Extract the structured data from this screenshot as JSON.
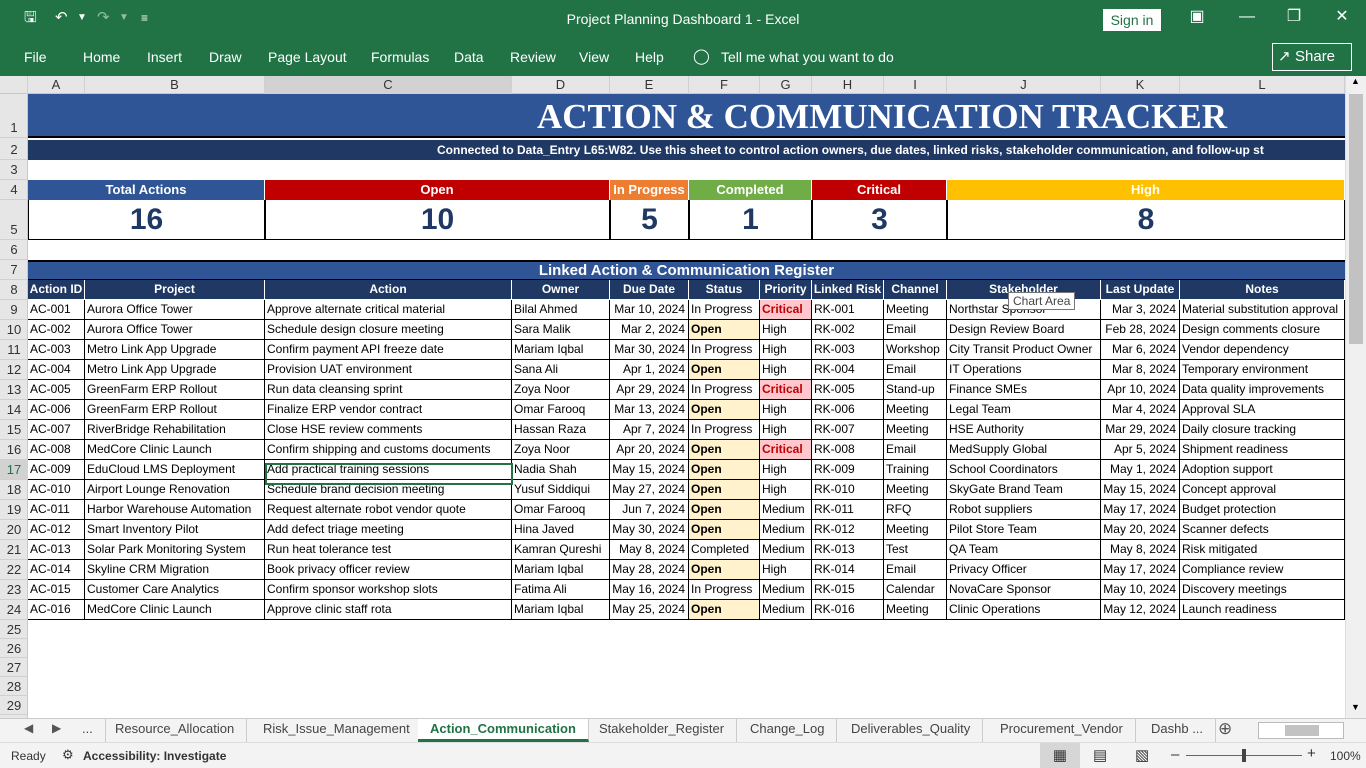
{
  "window": {
    "title": "Project Planning Dashboard 1  -  Excel",
    "sign_in": "Sign in"
  },
  "ribbon": {
    "tabs": [
      "File",
      "Home",
      "Insert",
      "Draw",
      "Page Layout",
      "Formulas",
      "Data",
      "Review",
      "View",
      "Help"
    ],
    "tell_me": "Tell me what you want to do",
    "share": "Share"
  },
  "columns": [
    "A",
    "B",
    "C",
    "D",
    "E",
    "F",
    "G",
    "H",
    "I",
    "J",
    "K",
    "L"
  ],
  "rows": [
    "1",
    "2",
    "3",
    "4",
    "5",
    "6",
    "7",
    "8",
    "9",
    "10",
    "11",
    "12",
    "13",
    "14",
    "15",
    "16",
    "17",
    "18",
    "19",
    "20",
    "21",
    "22",
    "23",
    "24",
    "25",
    "26",
    "27",
    "28",
    "29"
  ],
  "sheet": {
    "title": "ACTION & COMMUNICATION TRACKER",
    "subtitle": "Connected to Data_Entry L65:W82. Use this sheet to control action owners, due dates, linked risks, stakeholder communication, and follow-up st",
    "kpis": [
      {
        "label": "Total Actions",
        "value": "16",
        "color": "#2f5597"
      },
      {
        "label": "Open",
        "value": "10",
        "color": "#c00000"
      },
      {
        "label": "In Progress",
        "value": "5",
        "color": "#ed7d31"
      },
      {
        "label": "Completed",
        "value": "1",
        "color": "#70ad47"
      },
      {
        "label": "Critical",
        "value": "3",
        "color": "#c00000"
      },
      {
        "label": "High",
        "value": "8",
        "color": "#ffc000"
      }
    ],
    "register_title": "Linked Action & Communication Register",
    "headers": [
      "Action ID",
      "Project",
      "Action",
      "Owner",
      "Due Date",
      "Status",
      "Priority",
      "Linked Risk",
      "Channel",
      "Stakeholder",
      "Last Update",
      "Notes"
    ],
    "rows": [
      [
        "AC-001",
        "Aurora Office Tower",
        "Approve alternate critical material",
        "Bilal Ahmed",
        "Mar 10, 2024",
        "In Progress",
        "Critical",
        "RK-001",
        "Meeting",
        "Northstar Sponsor",
        "Mar 3, 2024",
        "Material substitution approval"
      ],
      [
        "AC-002",
        "Aurora Office Tower",
        "Schedule design closure meeting",
        "Sara Malik",
        "Mar 2, 2024",
        "Open",
        "High",
        "RK-002",
        "Email",
        "Design Review Board",
        "Feb 28, 2024",
        "Design comments closure"
      ],
      [
        "AC-003",
        "Metro Link App Upgrade",
        "Confirm payment API freeze date",
        "Mariam Iqbal",
        "Mar 30, 2024",
        "In Progress",
        "High",
        "RK-003",
        "Workshop",
        "City Transit Product Owner",
        "Mar 6, 2024",
        "Vendor dependency"
      ],
      [
        "AC-004",
        "Metro Link App Upgrade",
        "Provision UAT environment",
        "Sana Ali",
        "Apr 1, 2024",
        "Open",
        "High",
        "RK-004",
        "Email",
        "IT Operations",
        "Mar 8, 2024",
        "Temporary environment"
      ],
      [
        "AC-005",
        "GreenFarm ERP Rollout",
        "Run data cleansing sprint",
        "Zoya Noor",
        "Apr 29, 2024",
        "In Progress",
        "Critical",
        "RK-005",
        "Stand-up",
        "Finance SMEs",
        "Apr 10, 2024",
        "Data quality improvements"
      ],
      [
        "AC-006",
        "GreenFarm ERP Rollout",
        "Finalize ERP vendor contract",
        "Omar Farooq",
        "Mar 13, 2024",
        "Open",
        "High",
        "RK-006",
        "Meeting",
        "Legal Team",
        "Mar 4, 2024",
        "Approval SLA"
      ],
      [
        "AC-007",
        "RiverBridge Rehabilitation",
        "Close HSE review comments",
        "Hassan Raza",
        "Apr 7, 2024",
        "In Progress",
        "High",
        "RK-007",
        "Meeting",
        "HSE Authority",
        "Mar 29, 2024",
        "Daily closure tracking"
      ],
      [
        "AC-008",
        "MedCore Clinic Launch",
        "Confirm shipping and customs documents",
        "Zoya Noor",
        "Apr 20, 2024",
        "Open",
        "Critical",
        "RK-008",
        "Email",
        "MedSupply Global",
        "Apr 5, 2024",
        "Shipment readiness"
      ],
      [
        "AC-009",
        "EduCloud LMS Deployment",
        "Add practical training sessions",
        "Nadia Shah",
        "May 15, 2024",
        "Open",
        "High",
        "RK-009",
        "Training",
        "School Coordinators",
        "May 1, 2024",
        "Adoption support"
      ],
      [
        "AC-010",
        "Airport Lounge Renovation",
        "Schedule brand decision meeting",
        "Yusuf Siddiqui",
        "May 27, 2024",
        "Open",
        "High",
        "RK-010",
        "Meeting",
        "SkyGate Brand Team",
        "May 15, 2024",
        "Concept approval"
      ],
      [
        "AC-011",
        "Harbor Warehouse Automation",
        "Request alternate robot vendor quote",
        "Omar Farooq",
        "Jun 7, 2024",
        "Open",
        "Medium",
        "RK-011",
        "RFQ",
        "Robot suppliers",
        "May 17, 2024",
        "Budget protection"
      ],
      [
        "AC-012",
        "Smart Inventory Pilot",
        "Add defect triage meeting",
        "Hina Javed",
        "May 30, 2024",
        "Open",
        "Medium",
        "RK-012",
        "Meeting",
        "Pilot Store Team",
        "May 20, 2024",
        "Scanner defects"
      ],
      [
        "AC-013",
        "Solar Park Monitoring System",
        "Run heat tolerance test",
        "Kamran Qureshi",
        "May 8, 2024",
        "Completed",
        "Medium",
        "RK-013",
        "Test",
        "QA Team",
        "May 8, 2024",
        "Risk mitigated"
      ],
      [
        "AC-014",
        "Skyline CRM Migration",
        "Book privacy officer review",
        "Mariam Iqbal",
        "May 28, 2024",
        "Open",
        "High",
        "RK-014",
        "Email",
        "Privacy Officer",
        "May 17, 2024",
        "Compliance review"
      ],
      [
        "AC-015",
        "Customer Care Analytics",
        "Confirm sponsor workshop slots",
        "Fatima Ali",
        "May 16, 2024",
        "In Progress",
        "Medium",
        "RK-015",
        "Calendar",
        "NovaCare Sponsor",
        "May 10, 2024",
        "Discovery meetings"
      ],
      [
        "AC-016",
        "MedCore Clinic Launch",
        "Approve clinic staff rota",
        "Mariam Iqbal",
        "May 25, 2024",
        "Open",
        "Medium",
        "RK-016",
        "Meeting",
        "Clinic Operations",
        "May 12, 2024",
        "Launch readiness"
      ]
    ],
    "tooltip": "Chart Area"
  },
  "sheet_tabs": [
    "...",
    "Resource_Allocation",
    "Risk_Issue_Management",
    "Action_Communication",
    "Stakeholder_Register",
    "Change_Log",
    "Deliverables_Quality",
    "Procurement_Vendor",
    "Dashb  ..."
  ],
  "status": {
    "ready": "Ready",
    "accessibility": "Accessibility: Investigate",
    "zoom": "100%"
  }
}
